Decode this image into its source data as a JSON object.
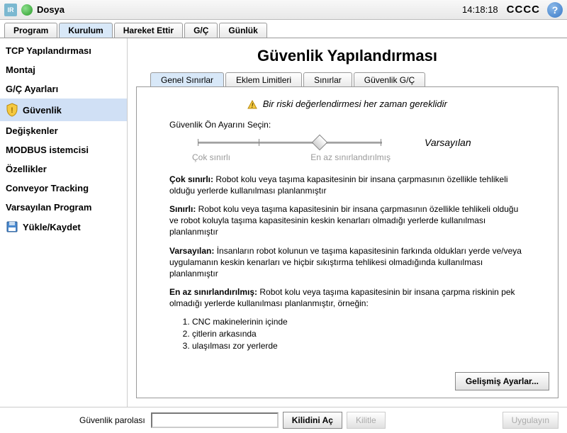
{
  "topbar": {
    "file_label": "Dosya",
    "time": "14:18:18",
    "status": "CCCC"
  },
  "main_tabs": [
    "Program",
    "Kurulum",
    "Hareket Ettir",
    "G/Ç",
    "Günlük"
  ],
  "main_tab_active": 1,
  "sidebar": {
    "items": [
      "TCP Yapılandırması",
      "Montaj",
      "G/Ç Ayarları",
      "Güvenlik",
      "Değişkenler",
      "MODBUS istemcisi",
      "Özellikler",
      "Conveyor Tracking",
      "Varsayılan Program",
      "Yükle/Kaydet"
    ],
    "active": 3
  },
  "page_title": "Güvenlik Yapılandırması",
  "sub_tabs": [
    "Genel Sınırlar",
    "Eklem Limitleri",
    "Sınırlar",
    "Güvenlik G/Ç"
  ],
  "sub_tab_active": 0,
  "warning": "Bir riski değerlendirmesi her zaman gereklidir",
  "preset": {
    "label": "Güvenlik Ön Ayarını Seçin:",
    "value_label": "Varsayılan",
    "left_label": "Çok sınırlı",
    "right_label": "En az sınırlandırılmış"
  },
  "descriptions": {
    "d1_title": "Çok sınırlı:",
    "d1_body": " Robot kolu veya taşıma kapasitesinin bir insana çarpmasının özellikle tehlikeli olduğu yerlerde kullanılması planlanmıştır",
    "d2_title": "Sınırlı:",
    "d2_body": " Robot kolu veya taşıma kapasitesinin bir insana çarpmasının özellikle tehlikeli olduğu ve robot koluyla taşıma kapasitesinin keskin kenarları olmadığı yerlerde kullanılması planlanmıştır",
    "d3_title": "Varsayılan:",
    "d3_body": " İnsanların robot kolunun ve taşıma kapasitesinin farkında oldukları yerde ve/veya uygulamanın keskin kenarları ve hiçbir sıkıştırma tehlikesi olmadığında kullanılması planlanmıştır",
    "d4_title": "En az sınırlandırılmış:",
    "d4_body": " Robot kolu veya taşıma kapasitesinin bir insana çarpma riskinin pek olmadığı yerlerde kullanılması planlanmıştır, örneğin:",
    "list": [
      "CNC makinelerinin içinde",
      "çitlerin arkasında",
      "ulaşılması zor yerlerde"
    ]
  },
  "advanced_btn": "Gelişmiş Ayarlar...",
  "bottom": {
    "password_label": "Güvenlik parolası",
    "unlock": "Kilidini Aç",
    "lock": "Kilitle",
    "apply": "Uygulayın"
  }
}
